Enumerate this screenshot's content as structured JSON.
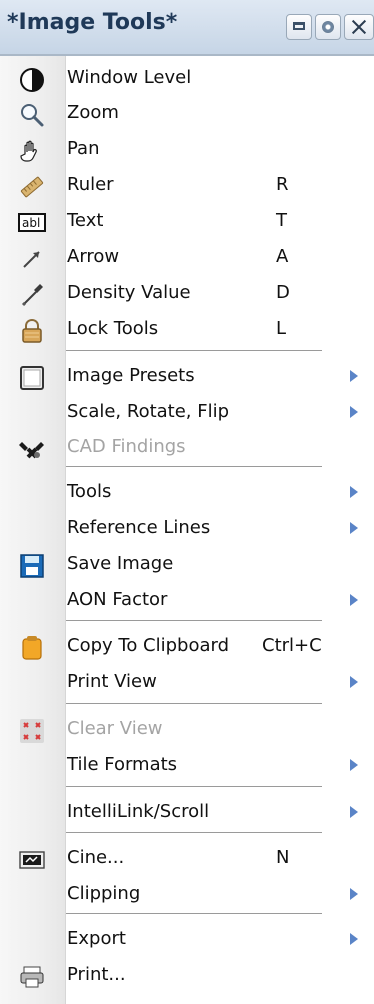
{
  "title": "*Image Tools*",
  "menu": {
    "items": [
      {
        "label": "Window Level",
        "shortcut": "",
        "submenu": false,
        "icon": "window-level-icon"
      },
      {
        "label": "Zoom",
        "shortcut": "",
        "submenu": false,
        "icon": "zoom-icon"
      },
      {
        "label": "Pan",
        "shortcut": "",
        "submenu": false,
        "icon": "pan-icon"
      },
      {
        "label": "Ruler",
        "shortcut": "R",
        "submenu": false,
        "icon": "ruler-icon"
      },
      {
        "label": "Text",
        "shortcut": "T",
        "submenu": false,
        "icon": "text-icon"
      },
      {
        "label": "Arrow",
        "shortcut": "A",
        "submenu": false,
        "icon": "arrow-icon"
      },
      {
        "label": "Density Value",
        "shortcut": "D",
        "submenu": false,
        "icon": "density-value-icon"
      },
      {
        "label": "Lock Tools",
        "shortcut": "L",
        "submenu": false,
        "icon": "lock-icon"
      },
      {
        "label": "Image Presets",
        "shortcut": "",
        "submenu": true,
        "icon": "image-presets-icon"
      },
      {
        "label": "Scale, Rotate, Flip",
        "shortcut": "",
        "submenu": true,
        "icon": ""
      },
      {
        "label": "CAD Findings",
        "shortcut": "",
        "submenu": false,
        "icon": "cad-findings-icon",
        "disabled": true
      },
      {
        "label": "Tools",
        "shortcut": "",
        "submenu": true,
        "icon": ""
      },
      {
        "label": "Reference Lines",
        "shortcut": "",
        "submenu": true,
        "icon": ""
      },
      {
        "label": "Save Image",
        "shortcut": "",
        "submenu": false,
        "icon": "save-image-icon"
      },
      {
        "label": "AON Factor",
        "shortcut": "",
        "submenu": true,
        "icon": ""
      },
      {
        "label": "Copy To Clipboard",
        "shortcut": "Ctrl+C",
        "submenu": false,
        "icon": "clipboard-icon"
      },
      {
        "label": "Print View",
        "shortcut": "",
        "submenu": true,
        "icon": ""
      },
      {
        "label": "Clear View",
        "shortcut": "",
        "submenu": false,
        "icon": "clear-view-icon",
        "disabled": true
      },
      {
        "label": "Tile Formats",
        "shortcut": "",
        "submenu": true,
        "icon": ""
      },
      {
        "label": "IntelliLink/Scroll",
        "shortcut": "",
        "submenu": true,
        "icon": ""
      },
      {
        "label": "Cine...",
        "shortcut": "N",
        "submenu": false,
        "icon": "cine-icon"
      },
      {
        "label": "Clipping",
        "shortcut": "",
        "submenu": true,
        "icon": ""
      },
      {
        "label": "Export",
        "shortcut": "",
        "submenu": true,
        "icon": ""
      },
      {
        "label": "Print...",
        "shortcut": "",
        "submenu": false,
        "icon": "printer-icon"
      }
    ]
  }
}
